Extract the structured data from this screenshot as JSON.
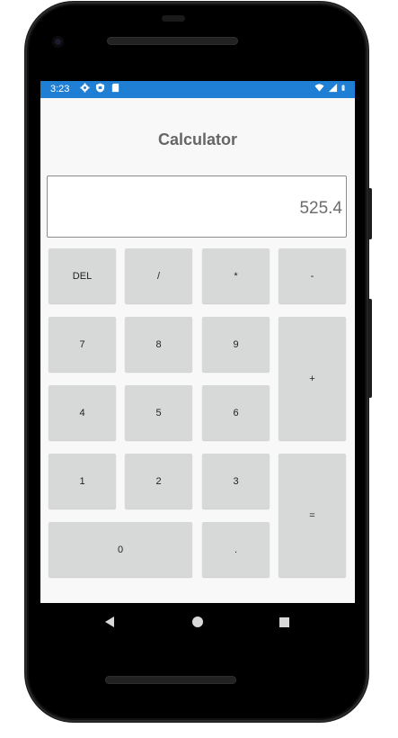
{
  "status_bar": {
    "time": "3:23",
    "left_icons": [
      "gear-icon",
      "shield-icon",
      "sd-card-icon"
    ],
    "right_icons": [
      "wifi-icon",
      "signal-icon",
      "battery-icon"
    ],
    "color": "#1e7fd4"
  },
  "app": {
    "title": "Calculator"
  },
  "display": {
    "value": "525.4"
  },
  "keys": {
    "del": "DEL",
    "divide": "/",
    "multiply": "*",
    "minus": "-",
    "seven": "7",
    "eight": "8",
    "nine": "9",
    "plus": "+",
    "four": "4",
    "five": "5",
    "six": "6",
    "one": "1",
    "two": "2",
    "three": "3",
    "equals": "=",
    "zero": "0",
    "dot": "."
  },
  "nav_bar": {
    "icons": [
      "back-icon",
      "home-icon",
      "recents-icon"
    ]
  },
  "colors": {
    "key_bg": "#d7d8d8",
    "screen_bg": "#f8f8f8"
  }
}
